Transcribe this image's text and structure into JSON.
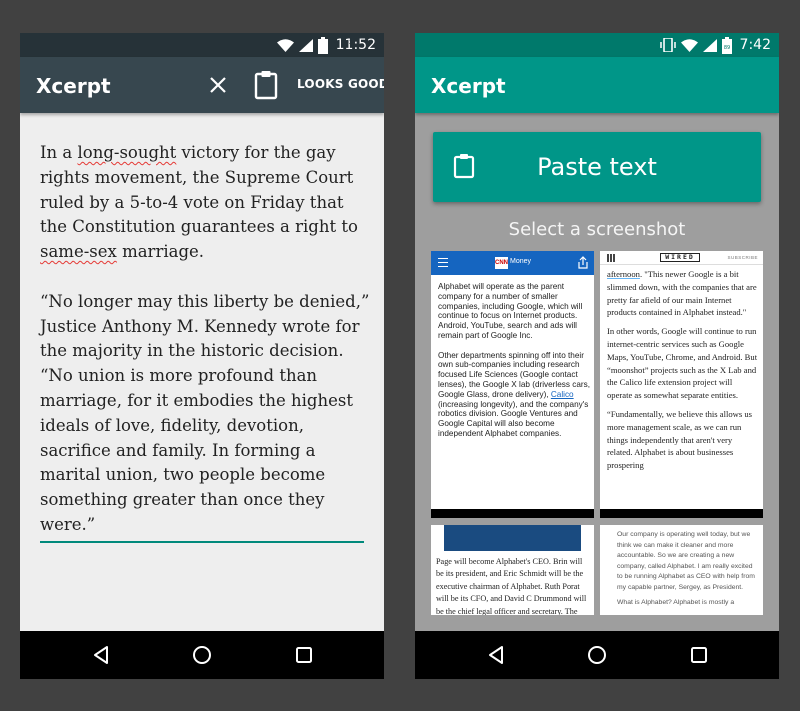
{
  "left": {
    "status": {
      "battery": "93",
      "time": "11:52"
    },
    "app_title": "Xcerpt",
    "looks_good": "LOOKS GOOD!",
    "excerpt": {
      "p1": {
        "pre": "In a ",
        "w1": "long-sought",
        "mid": " victory for the gay rights movement, the Supreme Court ruled by a 5-to-4 vote on Friday that the Constitution guarantees a right to ",
        "w2": "same-sex",
        "post": " marriage."
      },
      "p2": "“No longer may this liberty be denied,” Justice Anthony M. Kennedy wrote for the majority in the historic decision. “No union is more profound than marriage, for it embodies the highest ideals of love, fidelity, devotion, sacrifice and family. In forming a marital union, two people become something greater than once they were.”"
    }
  },
  "right": {
    "status": {
      "battery": "89",
      "time": "7:42"
    },
    "app_title": "Xcerpt",
    "paste_label": "Paste text",
    "select_label": "Select a screenshot",
    "thumbs": {
      "cnn": {
        "brand": "CNN",
        "section": "Money",
        "p1": "Alphabet will operate as the parent company for a number of smaller companies, including Google, which will continue to focus on Internet products. Android, YouTube, search and ads will remain part of Google Inc.",
        "p2a": "Other departments spinning off into their own sub-companies including research focused Life Sciences (Google contact lenses), the Google X lab (driverless cars, Google Glass, drone delivery), ",
        "p2link": "Calico",
        "p2b": " (increasing longevity), and the company's robotics division. Google Ventures and Google Capital will also become independent Alphabet companies."
      },
      "wired": {
        "logo": "WIRED",
        "subscribe": "SUBSCRIBE",
        "p1a": "afternoon",
        "p1b": ". \"This newer Google is a bit slimmed down, with the companies that are pretty far afield of our main Internet products contained in Alphabet instead.\"",
        "p2": "In other words, Google will continue to run internet-centric services such as Google Maps, YouTube, Chrome, and Android. But “moonshot” projects such as the X Lab and the Calico life extension project will operate as somewhat separate entities.",
        "p3": "“Fundamentally, we believe this allows us more management scale, as we can run things independently that aren't very related. Alphabet is about businesses prospering"
      },
      "third": {
        "text": "Page will become Alphabet's CEO. Brin will be its president, and Eric Schmidt will be the executive chairman of Alphabet. Ruth Porat will be its CFO, and David C Drummond will be the chief legal officer and secretary. The"
      },
      "fourth": {
        "text": "Our company is operating well today, but we think we can make it cleaner and more accountable. So we are creating a new company, called Alphabet. I am really excited to be running Alphabet as CEO with help from my capable partner, Sergey, as President.",
        "tail": "What is Alphabet? Alphabet is mostly a"
      }
    }
  },
  "colors": {
    "accent_teal": "#009688",
    "dark_appbar": "#37474f"
  }
}
